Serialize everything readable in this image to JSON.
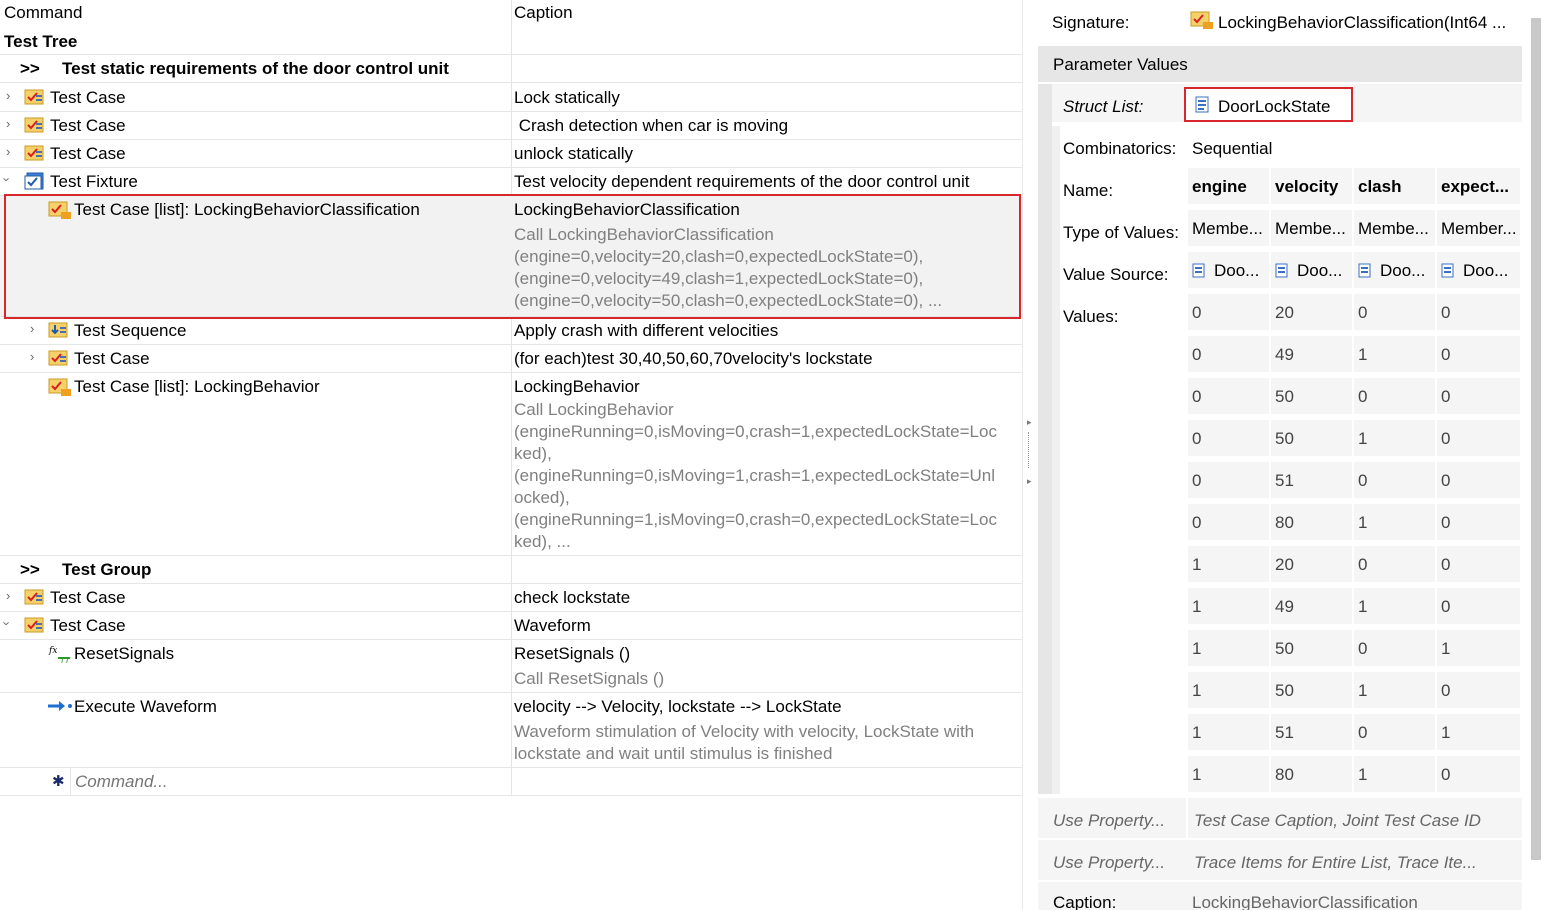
{
  "header": {
    "command": "Command",
    "caption": "Caption"
  },
  "tree": {
    "title": "Test Tree",
    "group1": {
      "prefix": ">>",
      "label": "Test static requirements of the door control unit"
    },
    "rows": [
      {
        "cmd": "Test Case",
        "cap": "Lock statically"
      },
      {
        "cmd": "Test Case",
        "cap": " Crash detection when car is moving"
      },
      {
        "cmd": "Test Case",
        "cap": "unlock statically"
      },
      {
        "cmd": "Test Fixture",
        "cap": "Test velocity dependent requirements of the door control unit"
      },
      {
        "cmd": "Test Case [list]: LockingBehaviorClassification",
        "cap": "LockingBehaviorClassification",
        "sub": [
          "Call LockingBehaviorClassification",
          "(engine=0,velocity=20,clash=0,expectedLockState=0),",
          "(engine=0,velocity=49,clash=1,expectedLockState=0),",
          "(engine=0,velocity=50,clash=0,expectedLockState=0), ..."
        ]
      },
      {
        "cmd": "Test Sequence",
        "cap": "Apply crash with different velocities"
      },
      {
        "cmd": "Test Case",
        "cap": "(for each)test 30,40,50,60,70velocity's lockstate"
      },
      {
        "cmd": "Test Case [list]: LockingBehavior",
        "cap": "LockingBehavior",
        "sub": [
          "Call LockingBehavior",
          "(engineRunning=0,isMoving=0,crash=1,expectedLockState=Loc",
          "ked),",
          "(engineRunning=0,isMoving=1,crash=1,expectedLockState=Unl",
          "ocked),",
          "(engineRunning=1,isMoving=0,crash=0,expectedLockState=Loc",
          "ked), ..."
        ]
      }
    ],
    "group2": {
      "prefix": ">>",
      "label": "Test Group"
    },
    "rows2": [
      {
        "cmd": "Test Case",
        "cap": "check lockstate"
      },
      {
        "cmd": "Test Case",
        "cap": "Waveform"
      },
      {
        "cmd": "ResetSignals",
        "cap": "ResetSignals ()",
        "sub": [
          "Call ResetSignals ()"
        ]
      },
      {
        "cmd": "Execute Waveform",
        "cap": "velocity --> Velocity, lockstate --> LockState",
        "sub": [
          "Waveform stimulation of Velocity with velocity, LockState with",
          "lockstate and wait until stimulus is finished"
        ]
      }
    ],
    "new_command_placeholder": "Command..."
  },
  "props": {
    "signature_label": "Signature:",
    "signature_value": "LockingBehaviorClassification(Int64 ...",
    "param_values_label": "Parameter Values",
    "struct_list_label": "Struct List:",
    "struct_list_value": "DoorLockState",
    "combinatorics_label": "Combinatorics:",
    "combinatorics_value": "Sequential",
    "name_label": "Name:",
    "type_label": "Type of Values:",
    "source_label": "Value Source:",
    "values_label": "Values:",
    "columns": [
      "engine",
      "velocity",
      "clash",
      "expect..."
    ],
    "types": [
      "Membe...",
      "Membe...",
      "Membe...",
      "Member..."
    ],
    "sources": [
      "Doo...",
      "Doo...",
      "Doo...",
      "Doo..."
    ],
    "values": [
      [
        "0",
        "20",
        "0",
        "0"
      ],
      [
        "0",
        "49",
        "1",
        "0"
      ],
      [
        "0",
        "50",
        "0",
        "0"
      ],
      [
        "0",
        "50",
        "1",
        "0"
      ],
      [
        "0",
        "51",
        "0",
        "0"
      ],
      [
        "0",
        "80",
        "1",
        "0"
      ],
      [
        "1",
        "20",
        "0",
        "0"
      ],
      [
        "1",
        "49",
        "1",
        "0"
      ],
      [
        "1",
        "50",
        "0",
        "1"
      ],
      [
        "1",
        "50",
        "1",
        "0"
      ],
      [
        "1",
        "51",
        "0",
        "1"
      ],
      [
        "1",
        "80",
        "1",
        "0"
      ]
    ],
    "use_property_label": "Use Property...",
    "use_property_1": "Test Case Caption, Joint Test Case ID",
    "use_property_2": "Trace Items for Entire List, Trace Ite...",
    "caption_label": "Caption:",
    "caption_value": "LockingBehaviorClassification"
  }
}
